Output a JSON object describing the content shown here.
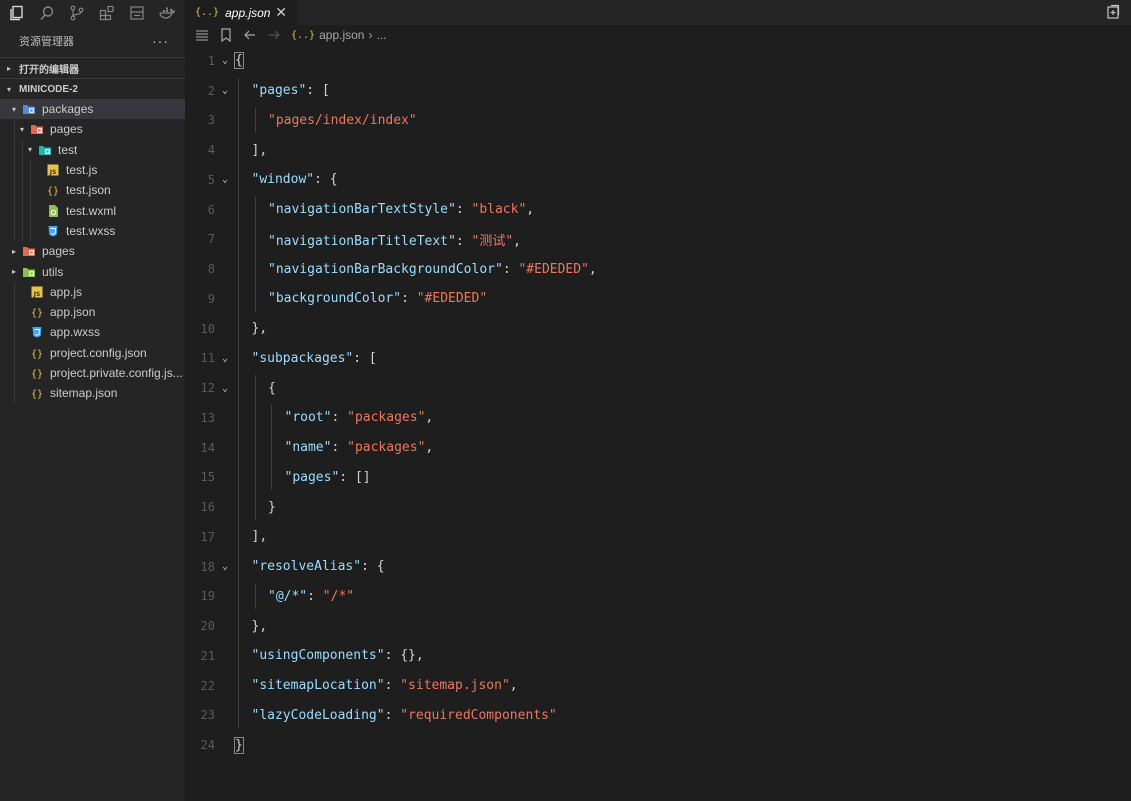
{
  "activity_icons": [
    "files-icon",
    "search-icon",
    "source-control-icon",
    "extensions-icon",
    "box-icon",
    "docker-icon"
  ],
  "explorer": {
    "title": "资源管理器",
    "more": "···",
    "open_editors": "打开的编辑器",
    "project": "MINICODE-2"
  },
  "tree": [
    {
      "label": "packages",
      "depth": 1,
      "type": "folder-blue",
      "caret": "▾",
      "active": true
    },
    {
      "label": "pages",
      "depth": 2,
      "type": "folder-orange",
      "caret": "▾"
    },
    {
      "label": "test",
      "depth": 3,
      "type": "folder-teal",
      "caret": "▾"
    },
    {
      "label": "test.js",
      "depth": 4,
      "type": "js"
    },
    {
      "label": "test.json",
      "depth": 4,
      "type": "json"
    },
    {
      "label": "test.wxml",
      "depth": 4,
      "type": "wxml"
    },
    {
      "label": "test.wxss",
      "depth": 4,
      "type": "wxss"
    },
    {
      "label": "pages",
      "depth": 1,
      "type": "folder-orange",
      "caret": "▸"
    },
    {
      "label": "utils",
      "depth": 1,
      "type": "folder-green",
      "caret": "▸"
    },
    {
      "label": "app.js",
      "depth": 2,
      "type": "js"
    },
    {
      "label": "app.json",
      "depth": 2,
      "type": "json"
    },
    {
      "label": "app.wxss",
      "depth": 2,
      "type": "wxss"
    },
    {
      "label": "project.config.json",
      "depth": 2,
      "type": "json"
    },
    {
      "label": "project.private.config.js...",
      "depth": 2,
      "type": "json"
    },
    {
      "label": "sitemap.json",
      "depth": 2,
      "type": "json"
    }
  ],
  "tab": {
    "icon": "{..}",
    "label": "app.json",
    "close": "✕"
  },
  "breadcrumb": {
    "icon": "{..}",
    "file": "app.json",
    "sep": "›",
    "rest": "..."
  },
  "code": [
    {
      "n": "1",
      "fold": "⌄",
      "indent": 0,
      "tokens": [
        [
          "p",
          "{"
        ]
      ]
    },
    {
      "n": "2",
      "fold": "⌄",
      "indent": 1,
      "tokens": [
        [
          "k",
          "\"pages\""
        ],
        [
          "p",
          ": ["
        ]
      ]
    },
    {
      "n": "3",
      "indent": 2,
      "tokens": [
        [
          "s",
          "\"pages/index/index\""
        ]
      ]
    },
    {
      "n": "4",
      "indent": 1,
      "tokens": [
        [
          "p",
          "],"
        ]
      ]
    },
    {
      "n": "5",
      "fold": "⌄",
      "indent": 1,
      "tokens": [
        [
          "k",
          "\"window\""
        ],
        [
          "p",
          ": {"
        ]
      ]
    },
    {
      "n": "6",
      "indent": 2,
      "tokens": [
        [
          "k",
          "\"navigationBarTextStyle\""
        ],
        [
          "p",
          ": "
        ],
        [
          "s",
          "\"black\""
        ],
        [
          "p",
          ","
        ]
      ]
    },
    {
      "n": "7",
      "indent": 2,
      "tokens": [
        [
          "k",
          "\"navigationBarTitleText\""
        ],
        [
          "p",
          ": "
        ],
        [
          "s",
          "\"测试\""
        ],
        [
          "p",
          ","
        ]
      ]
    },
    {
      "n": "8",
      "indent": 2,
      "tokens": [
        [
          "k",
          "\"navigationBarBackgroundColor\""
        ],
        [
          "p",
          ": "
        ],
        [
          "s",
          "\"#EDEDED\""
        ],
        [
          "p",
          ","
        ]
      ]
    },
    {
      "n": "9",
      "indent": 2,
      "tokens": [
        [
          "k",
          "\"backgroundColor\""
        ],
        [
          "p",
          ": "
        ],
        [
          "s",
          "\"#EDEDED\""
        ]
      ]
    },
    {
      "n": "10",
      "indent": 1,
      "tokens": [
        [
          "p",
          "},"
        ]
      ]
    },
    {
      "n": "11",
      "fold": "⌄",
      "indent": 1,
      "tokens": [
        [
          "k",
          "\"subpackages\""
        ],
        [
          "p",
          ": ["
        ]
      ]
    },
    {
      "n": "12",
      "fold": "⌄",
      "indent": 2,
      "tokens": [
        [
          "p",
          "{"
        ]
      ]
    },
    {
      "n": "13",
      "indent": 3,
      "tokens": [
        [
          "k",
          "\"root\""
        ],
        [
          "p",
          ": "
        ],
        [
          "s",
          "\"packages\""
        ],
        [
          "p",
          ","
        ]
      ]
    },
    {
      "n": "14",
      "indent": 3,
      "tokens": [
        [
          "k",
          "\"name\""
        ],
        [
          "p",
          ": "
        ],
        [
          "s",
          "\"packages\""
        ],
        [
          "p",
          ","
        ]
      ]
    },
    {
      "n": "15",
      "indent": 3,
      "tokens": [
        [
          "k",
          "\"pages\""
        ],
        [
          "p",
          ": []"
        ]
      ]
    },
    {
      "n": "16",
      "indent": 2,
      "tokens": [
        [
          "p",
          "}"
        ]
      ]
    },
    {
      "n": "17",
      "indent": 1,
      "tokens": [
        [
          "p",
          "],"
        ]
      ]
    },
    {
      "n": "18",
      "fold": "⌄",
      "indent": 1,
      "tokens": [
        [
          "k",
          "\"resolveAlias\""
        ],
        [
          "p",
          ": {"
        ]
      ]
    },
    {
      "n": "19",
      "indent": 2,
      "tokens": [
        [
          "k",
          "\"@/*\""
        ],
        [
          "p",
          ": "
        ],
        [
          "s",
          "\"/*\""
        ]
      ]
    },
    {
      "n": "20",
      "indent": 1,
      "tokens": [
        [
          "p",
          "},"
        ]
      ]
    },
    {
      "n": "21",
      "indent": 1,
      "tokens": [
        [
          "k",
          "\"usingComponents\""
        ],
        [
          "p",
          ": {},"
        ]
      ]
    },
    {
      "n": "22",
      "indent": 1,
      "tokens": [
        [
          "k",
          "\"sitemapLocation\""
        ],
        [
          "p",
          ": "
        ],
        [
          "s",
          "\"sitemap.json\""
        ],
        [
          "p",
          ","
        ]
      ]
    },
    {
      "n": "23",
      "indent": 1,
      "tokens": [
        [
          "k",
          "\"lazyCodeLoading\""
        ],
        [
          "p",
          ": "
        ],
        [
          "s",
          "\"requiredComponents\""
        ]
      ]
    },
    {
      "n": "24",
      "indent": 0,
      "tokens": [
        [
          "p",
          "}"
        ]
      ]
    }
  ],
  "colors": {
    "key": "#9cdcfe",
    "string": "#ec7760",
    "json_icon": "#e8c44d"
  }
}
